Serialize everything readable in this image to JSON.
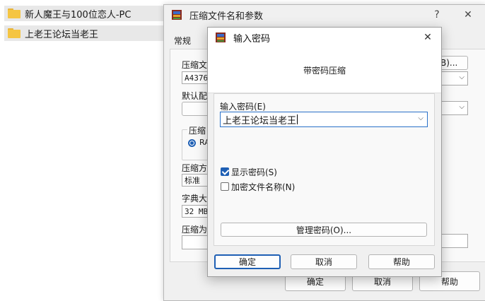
{
  "explorer": {
    "items": [
      {
        "label": "新人魔王与100位恋人-PC"
      },
      {
        "label": "上老王论坛当老王"
      }
    ]
  },
  "back_dialog": {
    "title": "压缩文件名和参数",
    "help_glyph": "?",
    "close_glyph": "✕",
    "tab_general": "常规",
    "archive_name_label": "压缩文",
    "archive_name_value": "A4376.",
    "browse_button_tail": "B)...",
    "default_config_label": "默认配",
    "format_group_label": "压缩",
    "format_radio_label": "RA",
    "method_label": "压缩方",
    "method_value": "标准",
    "dict_label": "字典大",
    "dict_value": "32 MB",
    "split_label": "压缩为",
    "ok_label": "确定",
    "cancel_label": "取消",
    "help_label": "帮助"
  },
  "password_dialog": {
    "title": "输入密码",
    "close_glyph": "✕",
    "header": "带密码压缩",
    "password_label": "输入密码(E)",
    "password_value": "上老王论坛当老王",
    "show_password_label": "显示密码(S)",
    "show_password_checked": true,
    "encrypt_names_label": "加密文件名称(N)",
    "encrypt_names_checked": false,
    "manage_label": "管理密码(O)...",
    "ok_label": "确定",
    "cancel_label": "取消",
    "help_label": "帮助"
  },
  "colors": {
    "accent": "#1e5fb4",
    "folder": "#f5c542"
  }
}
